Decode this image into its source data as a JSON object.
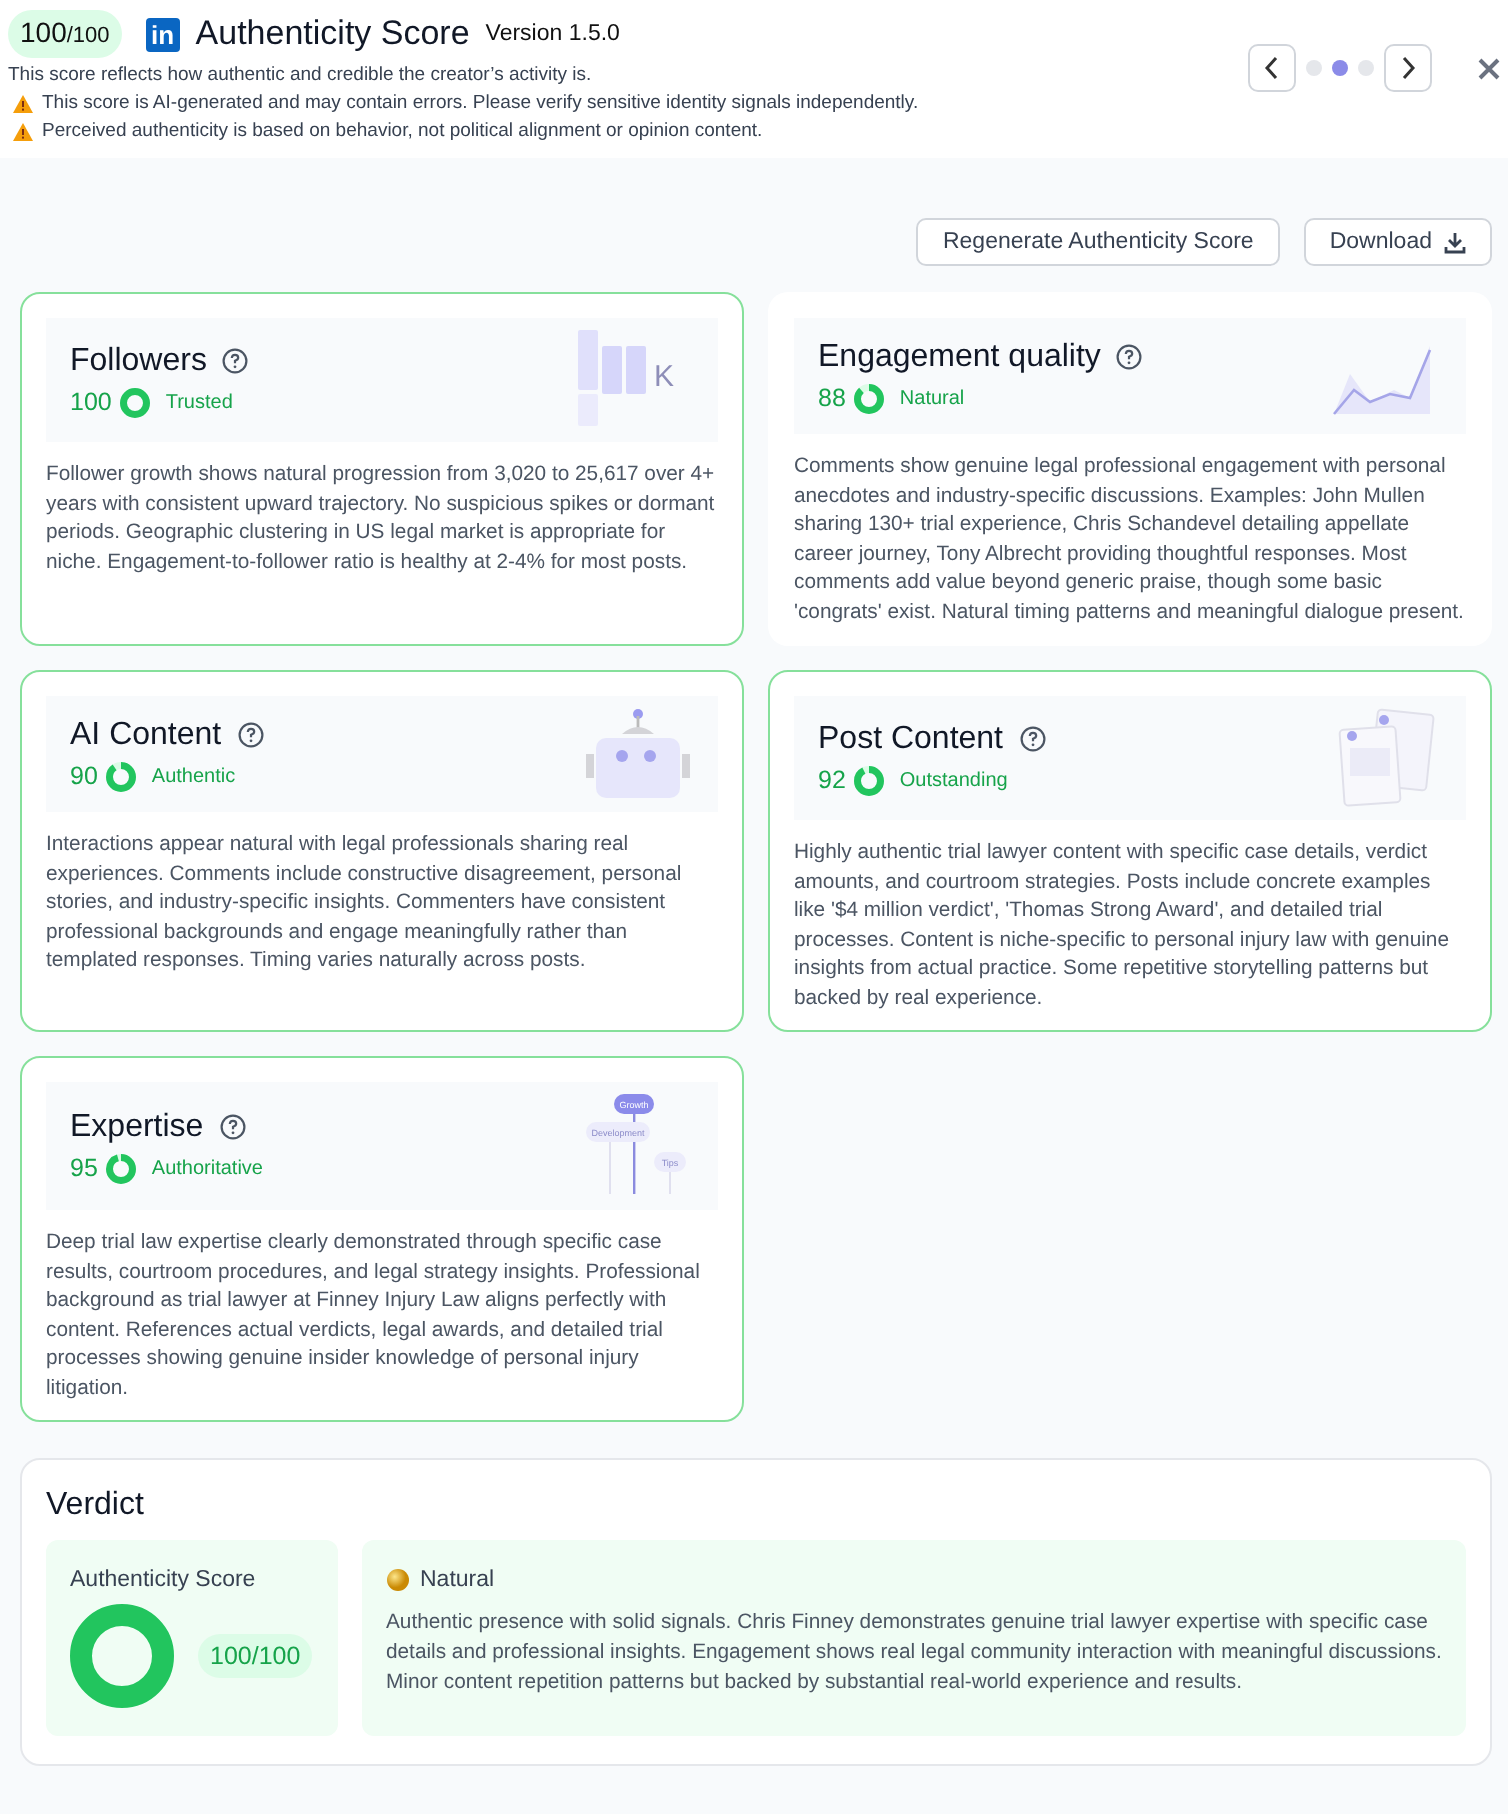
{
  "header": {
    "score": "100",
    "score_max": "/100",
    "logo_text": "in",
    "title": "Authenticity Score",
    "version": "Version 1.5.0",
    "notes": [
      {
        "kind": "info",
        "text": "This score reflects how authentic and credible the creator’s activity is."
      },
      {
        "kind": "warning",
        "text": "This score is AI-generated and may contain errors. Please verify sensitive identity signals independently."
      },
      {
        "kind": "warning",
        "text": "Perceived authenticity is based on behavior, not political alignment or opinion content."
      }
    ],
    "pager": [
      {
        "selected": false
      },
      {
        "selected": true
      },
      {
        "selected": false
      }
    ]
  },
  "actions": [
    "Regenerate Authenticity Score",
    "Download"
  ],
  "cards": [
    {
      "title": "Followers",
      "score": "100",
      "level": 1,
      "rating": "Trusted",
      "highlighted": true,
      "illustration": {
        "kind": "bars",
        "labels": [
          "K"
        ]
      },
      "text": "Follower growth shows natural progression from 3,020 to 25,617 over 4+ years with consistent upward trajectory. No suspicious spikes or dormant periods. Geographic clustering in US legal market is appropriate for niche. Engagement-to-follower ratio is healthy at 2-4% for most posts."
    },
    {
      "title": "Engagement quality",
      "score": "88",
      "level": 0.88,
      "rating": "Natural",
      "highlighted": false,
      "illustration": {
        "kind": "line"
      },
      "text": "Comments show genuine legal professional engagement with personal anecdotes and industry-specific discussions. Examples: John Mullen sharing 130+ trial experience, Chris Schandevel detailing appellate career journey, Tony Albrecht providing thoughtful responses. Most comments add value beyond generic praise, though some basic 'congrats' exist. Natural timing patterns and meaningful dialogue present."
    },
    {
      "title": "AI Content",
      "score": "90",
      "level": 0.9,
      "rating": "Authentic",
      "highlighted": true,
      "illustration": {
        "kind": "robot"
      },
      "text": "Interactions appear natural with legal professionals sharing real experiences. Comments include constructive disagreement, personal stories, and industry-specific insights. Commenters have consistent professional backgrounds and engage meaningfully rather than templated responses. Timing varies naturally across posts."
    },
    {
      "title": "Post Content",
      "score": "92",
      "level": 0.92,
      "rating": "Outstanding",
      "highlighted": true,
      "illustration": {
        "kind": "posts"
      },
      "text": "Highly authentic trial lawyer content with specific case details, verdict amounts, and courtroom strategies. Posts include concrete examples like '$4 million verdict', 'Thomas Strong Award', and detailed trial processes. Content is niche-specific to personal injury law with genuine insights from actual practice. Some repetitive storytelling patterns but backed by real experience."
    },
    {
      "title": "Expertise",
      "score": "95",
      "level": 0.95,
      "rating": "Authoritative",
      "highlighted": true,
      "illustration": {
        "kind": "tree",
        "labels": [
          "Growth",
          "Development",
          "Tips"
        ]
      },
      "text": "Deep trial law expertise clearly demonstrated through specific case results, courtroom procedures, and legal strategy insights. Professional background as trial lawyer at Finney Injury Law aligns perfectly with content. References actual verdicts, legal awards, and detailed trial processes showing genuine insider knowledge of personal injury litigation."
    }
  ],
  "verdict": {
    "title": "Verdict",
    "score_label": "Authenticity Score",
    "level": 1,
    "score": "100/100",
    "label": "Natural",
    "text": "Authentic presence with solid signals. Chris Finney demonstrates genuine trial lawyer expertise with specific case details and professional insights. Engagement shows real legal community interaction with meaningful discussions. Minor content repetition patterns but backed by substantial real-world experience and results."
  }
}
